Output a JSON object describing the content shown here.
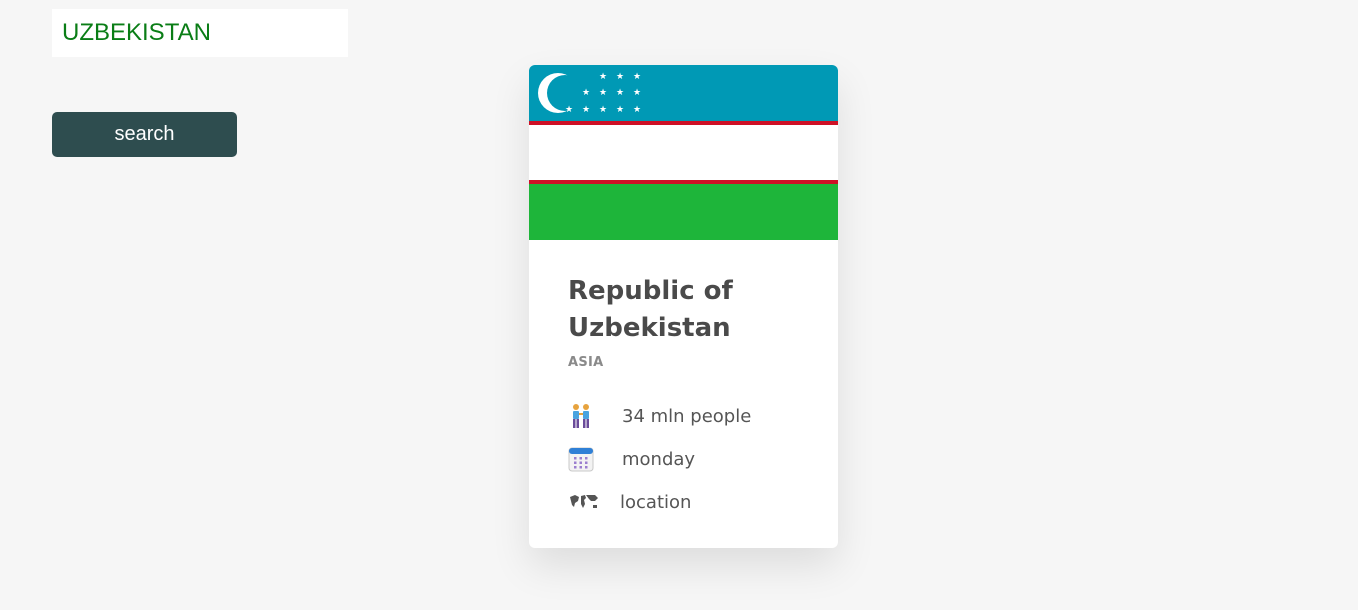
{
  "search": {
    "value": "UZBEKISTAN",
    "button_label": "search"
  },
  "card": {
    "official_name": "Republic of Uzbekistan",
    "region": "ASIA",
    "population": "34 mln people",
    "week_start": "monday",
    "location_label": "location",
    "flag": {
      "country": "Uzbekistan",
      "colors": {
        "blue": "#0099b5",
        "white": "#ffffff",
        "red": "#ce1126",
        "green": "#1eb53a"
      }
    },
    "icons": {
      "population": "people-icon",
      "week_start": "calendar-icon",
      "location": "world-map-icon"
    }
  },
  "colors": {
    "page_background": "#f6f6f6",
    "input_text": "#0a7d16",
    "button_background": "#2e4d4f",
    "button_text": "#ffffff",
    "card_title": "#4a4a4a",
    "card_region": "#8a8a8a"
  }
}
